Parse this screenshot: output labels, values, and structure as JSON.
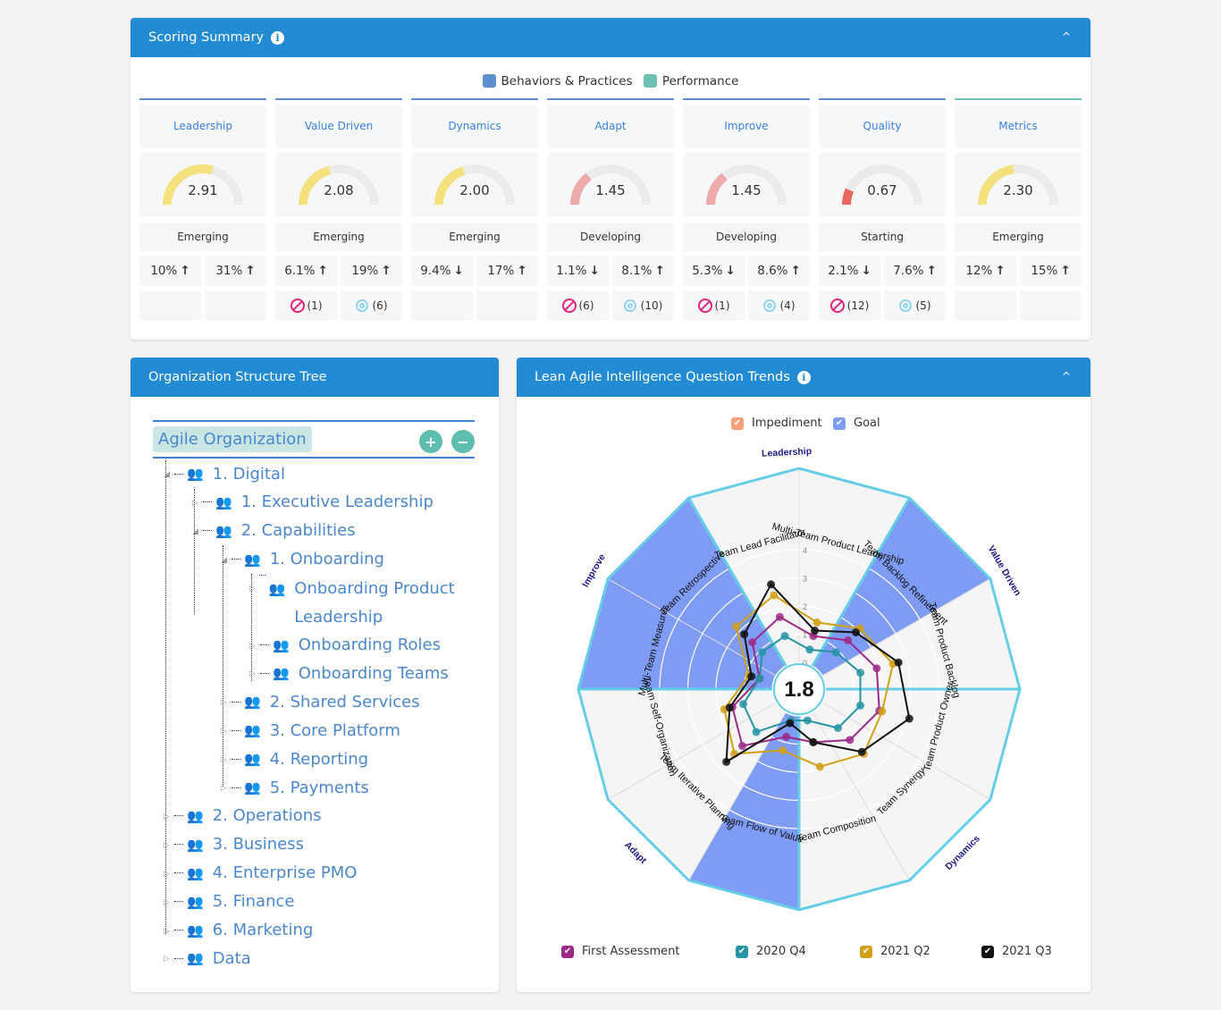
{
  "scoring": {
    "title": "Scoring Summary",
    "info_icon": "i",
    "collapse_icon": "^",
    "legend": [
      {
        "label": "Behaviors & Practices",
        "color": "#5b8fd0"
      },
      {
        "label": "Performance",
        "color": "#6cc1b3"
      }
    ],
    "columns": [
      {
        "name": "Leadership",
        "score": "2.91",
        "value": 2.91,
        "stage": "Emerging",
        "pct1": "10%",
        "dir1": "up",
        "pct2": "31%",
        "dir2": "up",
        "imp": "",
        "goal": "",
        "type": "bp"
      },
      {
        "name": "Value Driven",
        "score": "2.08",
        "value": 2.08,
        "stage": "Emerging",
        "pct1": "6.1%",
        "dir1": "up",
        "pct2": "19%",
        "dir2": "up",
        "imp": "(1)",
        "goal": "(6)",
        "type": "bp"
      },
      {
        "name": "Dynamics",
        "score": "2.00",
        "value": 2.0,
        "stage": "Emerging",
        "pct1": "9.4%",
        "dir1": "down",
        "pct2": "17%",
        "dir2": "up",
        "imp": "",
        "goal": "",
        "type": "bp"
      },
      {
        "name": "Adapt",
        "score": "1.45",
        "value": 1.45,
        "stage": "Developing",
        "pct1": "1.1%",
        "dir1": "down",
        "pct2": "8.1%",
        "dir2": "up",
        "imp": "(6)",
        "goal": "(10)",
        "type": "bp"
      },
      {
        "name": "Improve",
        "score": "1.45",
        "value": 1.45,
        "stage": "Developing",
        "pct1": "5.3%",
        "dir1": "down",
        "pct2": "8.6%",
        "dir2": "up",
        "imp": "(1)",
        "goal": "(4)",
        "type": "bp"
      },
      {
        "name": "Quality",
        "score": "0.67",
        "value": 0.67,
        "stage": "Starting",
        "pct1": "2.1%",
        "dir1": "down",
        "pct2": "7.6%",
        "dir2": "up",
        "imp": "(12)",
        "goal": "(5)",
        "type": "bp"
      },
      {
        "name": "Metrics",
        "score": "2.30",
        "value": 2.3,
        "stage": "Emerging",
        "pct1": "12%",
        "dir1": "up",
        "pct2": "15%",
        "dir2": "up",
        "imp": "",
        "goal": "",
        "type": "perf"
      }
    ],
    "gauge_max": 5,
    "colors": {
      "emerging": "#f5e27e",
      "developing": "#eeaaaa",
      "starting": "#e8675f",
      "track": "#ebebeb"
    }
  },
  "tree": {
    "title": "Organization Structure Tree",
    "root": "Agile Organization",
    "expand_label": "+",
    "collapse_label": "−",
    "nodes": [
      {
        "label": "1. Digital",
        "depth": 0,
        "expanded": true
      },
      {
        "label": "1. Executive Leadership",
        "depth": 1,
        "expanded": false
      },
      {
        "label": "2. Capabilities",
        "depth": 1,
        "expanded": true
      },
      {
        "label": "1. Onboarding",
        "depth": 2,
        "expanded": true
      },
      {
        "label": "Onboarding Product Leadership",
        "depth": 3,
        "expanded": false
      },
      {
        "label": "Onboarding Roles",
        "depth": 3,
        "expanded": false
      },
      {
        "label": "Onboarding Teams",
        "depth": 3,
        "expanded": false
      },
      {
        "label": "2. Shared Services",
        "depth": 2,
        "expanded": false
      },
      {
        "label": "3. Core Platform",
        "depth": 2,
        "expanded": false
      },
      {
        "label": "4. Reporting",
        "depth": 2,
        "expanded": false
      },
      {
        "label": "5. Payments",
        "depth": 2,
        "expanded": false
      },
      {
        "label": "2. Operations",
        "depth": 0,
        "expanded": false
      },
      {
        "label": "3. Business",
        "depth": 0,
        "expanded": false
      },
      {
        "label": "4. Enterprise PMO",
        "depth": 0,
        "expanded": false
      },
      {
        "label": "5. Finance",
        "depth": 0,
        "expanded": false
      },
      {
        "label": "6. Marketing",
        "depth": 0,
        "expanded": false
      },
      {
        "label": "Data",
        "depth": 0,
        "expanded": false
      }
    ]
  },
  "trends": {
    "title": "Lean Agile Intelligence Question Trends",
    "top_legend": [
      {
        "label": "Impediment",
        "color": "#f4a07a"
      },
      {
        "label": "Goal",
        "color": "#7f9cf5"
      }
    ],
    "bottom_legend": [
      {
        "label": "First Assessment",
        "color": "#9b2a86"
      },
      {
        "label": "2020 Q4",
        "color": "#2694a3"
      },
      {
        "label": "2021 Q2",
        "color": "#d1a019"
      },
      {
        "label": "2021 Q3",
        "color": "#111111"
      }
    ],
    "center_value": "1.8"
  },
  "chart_data": {
    "type": "radar",
    "title": "Lean Agile Intelligence Question Trends",
    "center_label": "1.8",
    "radial_ticks": [
      "0",
      "1",
      "2",
      "3",
      "4"
    ],
    "range": [
      0,
      4
    ],
    "categories": [
      "Team Lead Facilitator",
      "Multi-Team Product Leadership",
      "Team Backlog Refinement",
      "Team Product Backlog",
      "Team Product Owner",
      "Team Synergy",
      "Team Composition",
      "Team Flow of Value",
      "Team Iterative Planning",
      "Team Self-Organization",
      "Multi-Team Measures",
      "Team Retrospective"
    ],
    "groups": [
      {
        "name": "Leadership",
        "categories": [
          "Team Lead Facilitator",
          "Multi-Team Product Leadership"
        ]
      },
      {
        "name": "Value Driven",
        "categories": [
          "Team Backlog Refinement",
          "Team Product Backlog"
        ]
      },
      {
        "name": "Dynamics",
        "categories": [
          "Team Product Owner",
          "Team Synergy",
          "Team Composition"
        ]
      },
      {
        "name": "Adapt",
        "categories": [
          "Team Flow of Value",
          "Team Iterative Planning",
          "Team Self-Organization"
        ]
      },
      {
        "name": "Improve",
        "categories": [
          "Multi-Team Measures",
          "Team Retrospective"
        ]
      }
    ],
    "goal_categories": [
      "Team Backlog Refinement",
      "Team Flow of Value",
      "Multi-Team Measures",
      "Team Retrospective"
    ],
    "series": [
      {
        "name": "First Assessment",
        "color": "#9b2a86",
        "values": [
          1.7,
          1.0,
          1.5,
          1.9,
          2.0,
          1.6,
          1.0,
          0.8,
          1.9,
          1.5,
          0.5,
          1.4
        ]
      },
      {
        "name": "2020 Q4",
        "color": "#2694a3",
        "values": [
          1.0,
          0.5,
          0.9,
          1.3,
          1.3,
          1.0,
          0.2,
          0.2,
          1.2,
          1.1,
          0.5,
          0.9
        ]
      },
      {
        "name": "2021 Q2",
        "color": "#d1a019",
        "values": [
          2.5,
          1.5,
          2.1,
          2.5,
          2.1,
          2.3,
          1.9,
          1.3,
          2.3,
          1.8,
          0.9,
          2.2
        ]
      },
      {
        "name": "2021 Q3",
        "color": "#111111",
        "values": [
          2.9,
          1.2,
          1.9,
          2.7,
          3.1,
          2.2,
          1.0,
          0.3,
          2.7,
          1.6,
          0.8,
          1.8
        ]
      }
    ]
  }
}
